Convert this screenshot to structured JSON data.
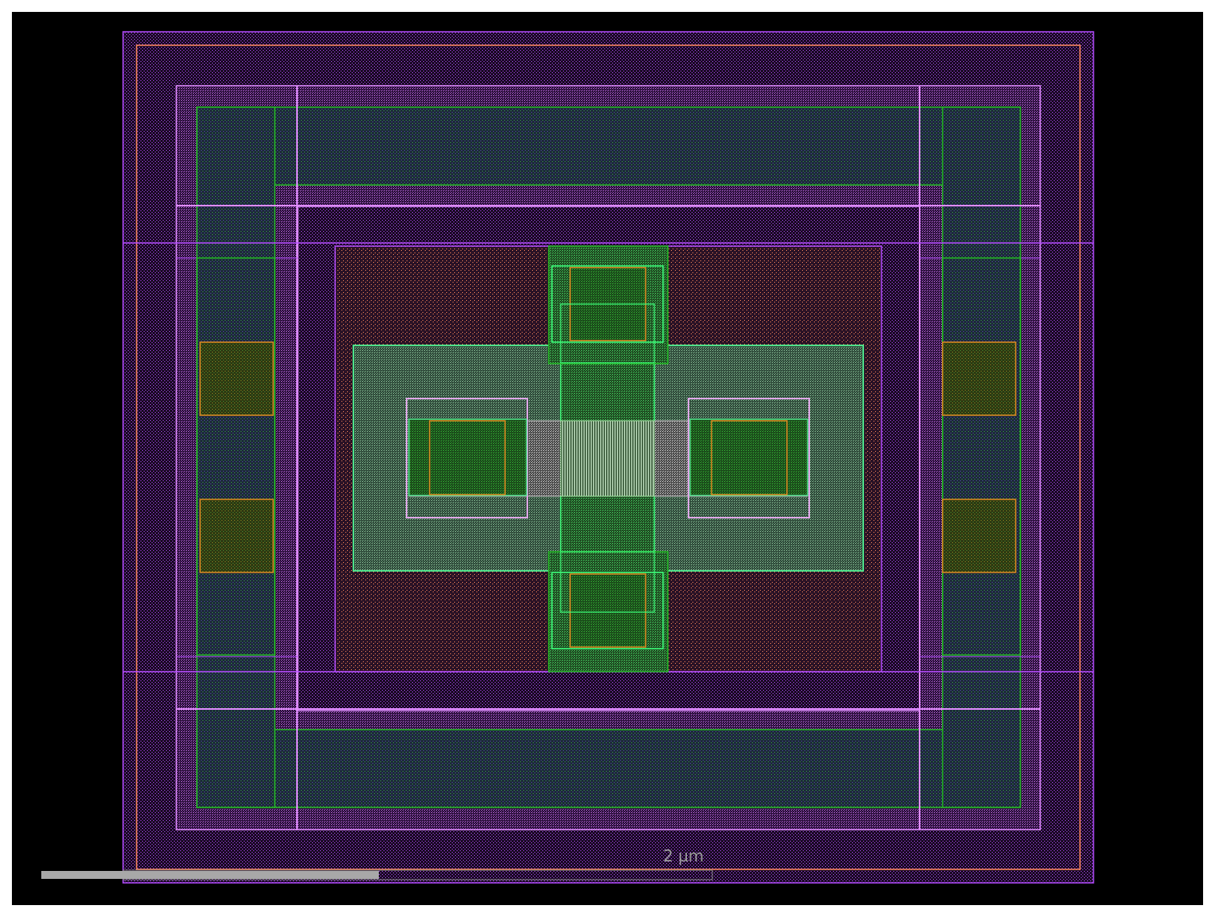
{
  "canvas": {
    "background": "#000000",
    "frame_color": "#ffffff"
  },
  "scale_bar": {
    "label": "2 µm",
    "bar_color": "#a8a8a8"
  },
  "layers": {
    "nwell": {
      "stroke": "#b44cff",
      "fill": "#b44cff"
    },
    "implant": {
      "stroke": "#ff8a5c",
      "fill": "#ff8a5c"
    },
    "diffusion": {
      "stroke": "#22b822",
      "fill": "#1f9a1f"
    },
    "poly": {
      "stroke": "#3cff7a",
      "fill": "#2fc060"
    },
    "metal": {
      "stroke": "#e08cff",
      "fill": "#d07cf0"
    },
    "contact": {
      "stroke": "#e08a20",
      "fill": "#5a5a10"
    },
    "active": {
      "stroke": "#4fe08a",
      "fill": "#7a7a7a"
    }
  }
}
